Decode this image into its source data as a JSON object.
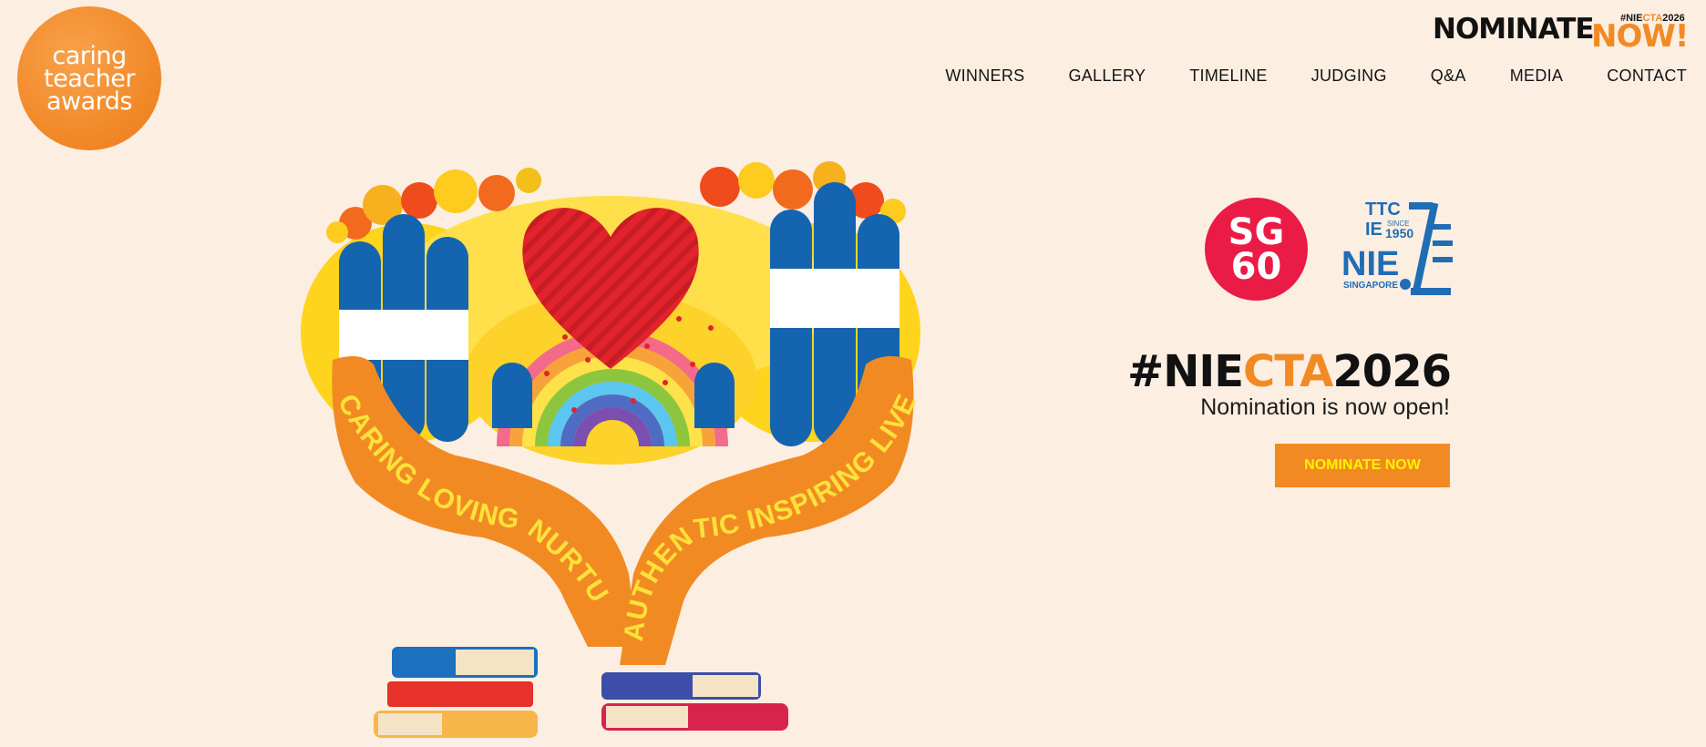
{
  "logo": {
    "lines": [
      "caring",
      "teacher",
      "awards"
    ]
  },
  "banner": {
    "word": "NOMINATE",
    "now": "NOW!",
    "tag_prefix": "#NIE",
    "tag_mid": "CTA",
    "tag_suffix": "2026"
  },
  "nav": {
    "items": [
      "WINNERS",
      "GALLERY",
      "TIMELINE",
      "JUDGING",
      "Q&A",
      "MEDIA",
      "CONTACT"
    ]
  },
  "hero": {
    "left_words": "CARING LOVING NURTURING",
    "right_words": "AUTHENTIC INSPIRING LIVES SELFLESS"
  },
  "partners": {
    "sg60": {
      "line1": "SG",
      "line2": "60"
    },
    "nie": {
      "ttc": "TTC",
      "ie": "IE",
      "since": "SINCE",
      "year": "1950",
      "nie": "NIE",
      "country": "SINGAPORE"
    }
  },
  "campaign": {
    "hashtag_prefix": "#NIE",
    "hashtag_mid": "CTA",
    "hashtag_suffix": "2026",
    "subtitle": "Nomination is now open!",
    "cta_label": "NOMINATE NOW"
  },
  "colors": {
    "background": "#fdeee2",
    "accent": "#f28a24",
    "cta_text": "#fff200",
    "sg60_red": "#ea1b45",
    "nie_blue": "#1f6db5"
  }
}
